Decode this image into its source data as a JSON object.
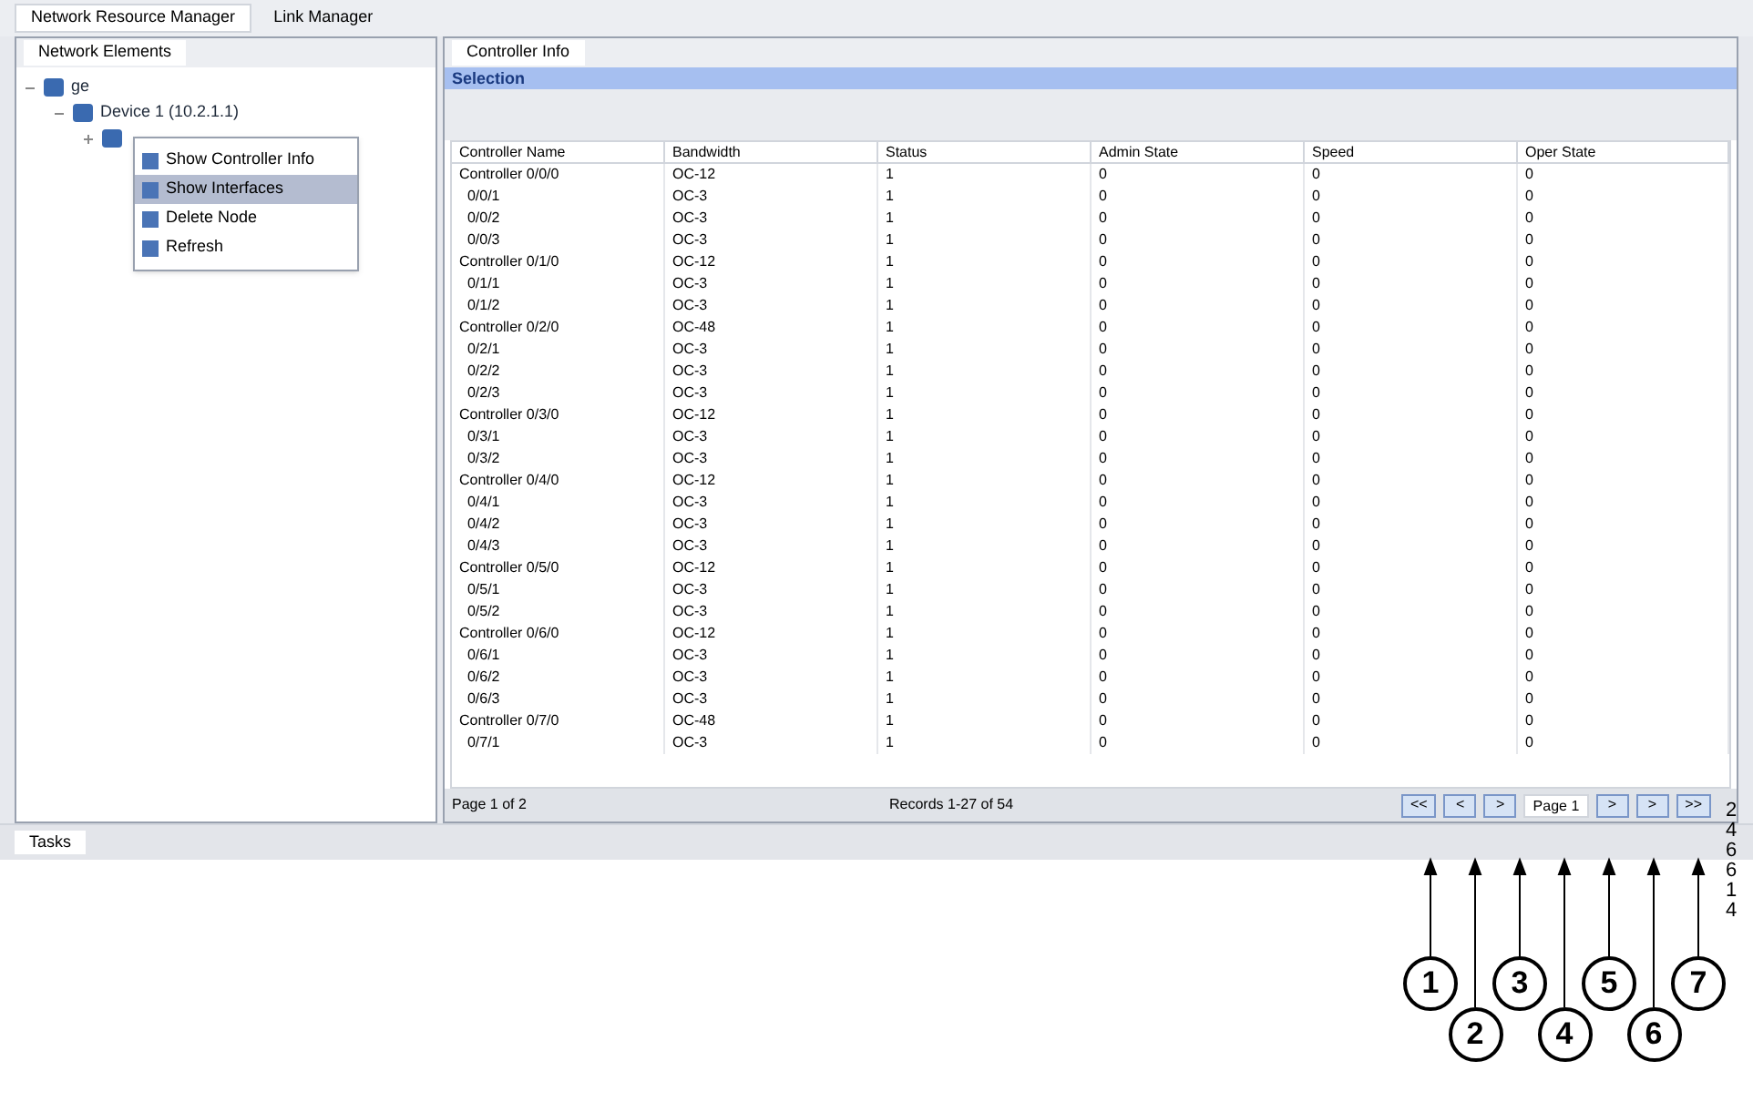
{
  "perspective_tabs": [
    {
      "label": "Network Resource Manager",
      "selected": true
    },
    {
      "label": "Link Manager",
      "selected": false
    }
  ],
  "left_view": {
    "tab": "Network Elements",
    "tree": [
      {
        "label": "ge",
        "expanded": true,
        "children": [
          {
            "label": "Device 1 (10.2.1.1)",
            "expanded": true,
            "children": [
              {
                "expanded": false
              }
            ]
          }
        ]
      }
    ]
  },
  "context_menu": [
    {
      "label": "Show Controller Info",
      "selected": false
    },
    {
      "label": "Show Interfaces",
      "selected": true
    },
    {
      "label": "Delete Node",
      "selected": false
    },
    {
      "label": "Refresh",
      "selected": false
    }
  ],
  "right_view": {
    "tab": "Controller Info",
    "title": "Selection",
    "table": {
      "columns": [
        "Controller Name",
        "Bandwidth",
        "Status",
        "Admin State",
        "Speed",
        "Oper State"
      ],
      "rows": [
        [
          "Controller 0/0/0",
          "OC-12",
          "1",
          "0",
          "0",
          "0"
        ],
        [
          "  0/0/1",
          "OC-3",
          "1",
          "0",
          "0",
          "0"
        ],
        [
          "  0/0/2",
          "OC-3",
          "1",
          "0",
          "0",
          "0"
        ],
        [
          "  0/0/3",
          "OC-3",
          "1",
          "0",
          "0",
          "0"
        ],
        [
          "Controller 0/1/0",
          "OC-12",
          "1",
          "0",
          "0",
          "0"
        ],
        [
          "  0/1/1",
          "OC-3",
          "1",
          "0",
          "0",
          "0"
        ],
        [
          "  0/1/2",
          "OC-3",
          "1",
          "0",
          "0",
          "0"
        ],
        [
          "Controller 0/2/0",
          "OC-48",
          "1",
          "0",
          "0",
          "0"
        ],
        [
          "  0/2/1",
          "OC-3",
          "1",
          "0",
          "0",
          "0"
        ],
        [
          "  0/2/2",
          "OC-3",
          "1",
          "0",
          "0",
          "0"
        ],
        [
          "  0/2/3",
          "OC-3",
          "1",
          "0",
          "0",
          "0"
        ],
        [
          "Controller 0/3/0",
          "OC-12",
          "1",
          "0",
          "0",
          "0"
        ],
        [
          "  0/3/1",
          "OC-3",
          "1",
          "0",
          "0",
          "0"
        ],
        [
          "  0/3/2",
          "OC-3",
          "1",
          "0",
          "0",
          "0"
        ],
        [
          "Controller 0/4/0",
          "OC-12",
          "1",
          "0",
          "0",
          "0"
        ],
        [
          "  0/4/1",
          "OC-3",
          "1",
          "0",
          "0",
          "0"
        ],
        [
          "  0/4/2",
          "OC-3",
          "1",
          "0",
          "0",
          "0"
        ],
        [
          "  0/4/3",
          "OC-3",
          "1",
          "0",
          "0",
          "0"
        ],
        [
          "Controller 0/5/0",
          "OC-12",
          "1",
          "0",
          "0",
          "0"
        ],
        [
          "  0/5/1",
          "OC-3",
          "1",
          "0",
          "0",
          "0"
        ],
        [
          "  0/5/2",
          "OC-3",
          "1",
          "0",
          "0",
          "0"
        ],
        [
          "Controller 0/6/0",
          "OC-12",
          "1",
          "0",
          "0",
          "0"
        ],
        [
          "  0/6/1",
          "OC-3",
          "1",
          "0",
          "0",
          "0"
        ],
        [
          "  0/6/2",
          "OC-3",
          "1",
          "0",
          "0",
          "0"
        ],
        [
          "  0/6/3",
          "OC-3",
          "1",
          "0",
          "0",
          "0"
        ],
        [
          "Controller 0/7/0",
          "OC-48",
          "1",
          "0",
          "0",
          "0"
        ],
        [
          "  0/7/1",
          "OC-3",
          "1",
          "0",
          "0",
          "0"
        ]
      ]
    },
    "footer": {
      "page_info": "Page 1 of 2",
      "records": "Records 1-27 of 54",
      "pager": [
        {
          "kind": "button",
          "label": "<<"
        },
        {
          "kind": "button",
          "label": "<"
        },
        {
          "kind": "button",
          "label": ">"
        },
        {
          "kind": "field",
          "label": "Page 1"
        },
        {
          "kind": "button",
          "label": ">"
        },
        {
          "kind": "button",
          "label": ">"
        },
        {
          "kind": "button",
          "label": ">>"
        }
      ]
    }
  },
  "bottom_tab": "Tasks",
  "callouts": [
    "1",
    "2",
    "3",
    "4",
    "5",
    "6",
    "7"
  ],
  "figure_id": "246614"
}
